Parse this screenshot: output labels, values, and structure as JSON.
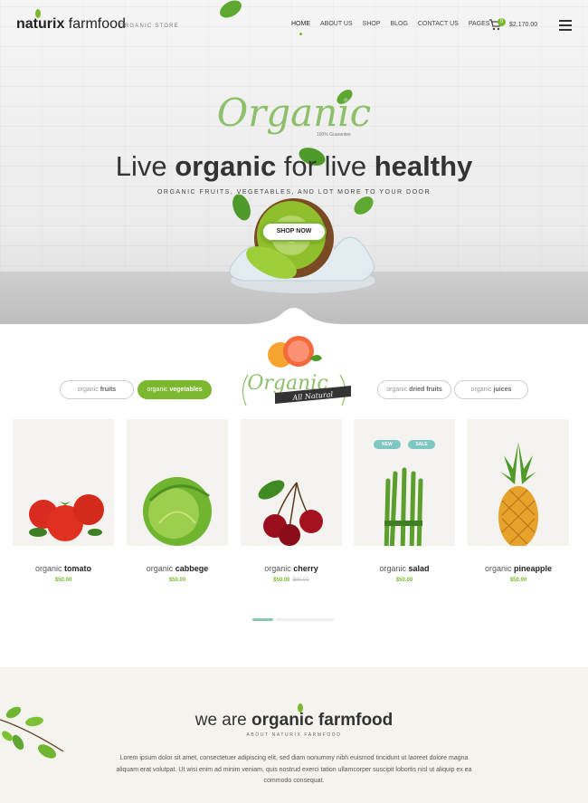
{
  "header": {
    "logo_bold": "naturix",
    "logo_light": "farmfood",
    "tagline": "ORGANIC STORE",
    "nav": [
      "HOME",
      "ABOUT US",
      "SHOP",
      "BLOG",
      "CONTACT US",
      "PAGES"
    ],
    "cart_count": "0",
    "cart_total": "$2,170.00"
  },
  "hero": {
    "script_word": "Organic",
    "guarantee": "100% Guarantee",
    "title_1": "Live ",
    "title_2": "organic",
    "title_3": " for live ",
    "title_4": "healthy",
    "subtitle": "ORGANIC FRUITS, VEGETABLES, AND LOT MORE TO YOUR DOOR",
    "button": "SHOP NOW"
  },
  "badge": {
    "script": "Organic",
    "ribbon": "All Natural"
  },
  "filters": [
    {
      "light": "organic",
      "bold": "fruits"
    },
    {
      "light": "organic",
      "bold": "vegetables"
    },
    {
      "light": "organic",
      "bold": "dried fruits"
    },
    {
      "light": "organic",
      "bold": "juices"
    }
  ],
  "products": [
    {
      "light": "organic",
      "bold": "tomato",
      "price": "$50.00",
      "old_price": ""
    },
    {
      "light": "organic",
      "bold": "cabbege",
      "price": "$50.00",
      "old_price": ""
    },
    {
      "light": "organic",
      "bold": "cherry",
      "price": "$50.00",
      "old_price": "$60.00"
    },
    {
      "light": "organic",
      "bold": "salad",
      "price": "$50.00",
      "old_price": ""
    },
    {
      "light": "organic",
      "bold": "pineapple",
      "price": "$50.00",
      "old_price": ""
    }
  ],
  "tags": {
    "new": "NEW",
    "sale": "SALE"
  },
  "about": {
    "title_light": "we are ",
    "title_bold": "organic farmfood",
    "subtitle": "ABOUT NATURIX FARMFOOD",
    "text": "Lorem ipsum dolor sit amet, consectetuer adipiscing elit, sed diam nonummy nibh euismod tincidunt ut laoreet dolore magna aliquam erat volutpat. Ut wisi enim ad minim veniam, quis nostrud exerci tation ullamcorper suscipit lobortis nisl ut aliquip ex ea commodo consequat."
  },
  "colors": {
    "accent": "#7cb82f",
    "teal": "#7fc7c2",
    "about_bg": "#f4f3ee"
  }
}
